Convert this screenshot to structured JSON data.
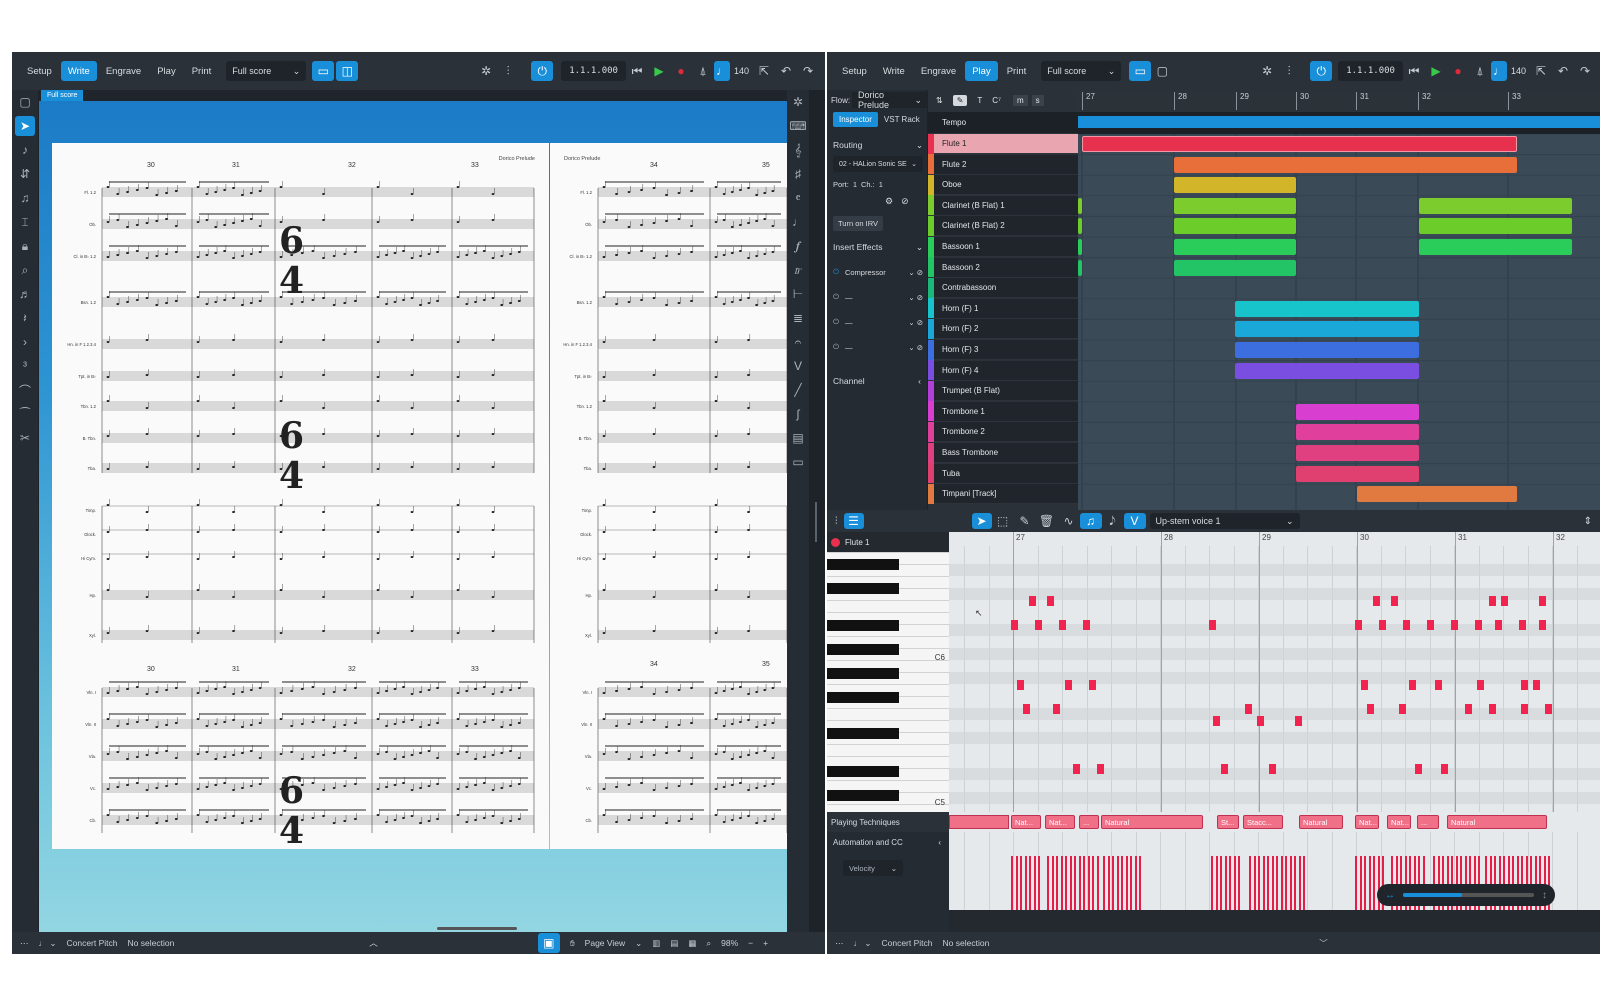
{
  "left": {
    "modes": [
      "Setup",
      "Write",
      "Engrave",
      "Play",
      "Print"
    ],
    "active_mode": "Write",
    "layout_select": "Full score",
    "counter": "1.1.1.000",
    "tempo": "140",
    "tab": "Full score",
    "status": {
      "pitch": "Concert Pitch",
      "selection": "No selection",
      "view": "Page View",
      "zoom": "98%"
    },
    "page_header": "Dorico Prelude",
    "bar_numbers_top": [
      "30",
      "31",
      "32",
      "33"
    ],
    "bar_numbers_bottom": [
      "30",
      "31",
      "32",
      "33"
    ],
    "bar_numbers_right": [
      "34",
      "35"
    ],
    "staff_labels": [
      "Fl. 1.2",
      "Ob.",
      "Cl. in B♭ 1.2",
      "Bsn. 1.2",
      "Hn. in F 1.2.3.4",
      "Tpt. in B♭",
      "Tbn. 1.2",
      "B. Tbn.",
      "Tba.",
      "Timp.",
      "Glock.",
      "Hi Cym.",
      "Hp.",
      "Xyl.",
      "Vln. I",
      "Vln. II",
      "Vla.",
      "Vc.",
      "Cb."
    ],
    "time_signature": {
      "num": "6",
      "den": "4"
    }
  },
  "right": {
    "modes": [
      "Setup",
      "Write",
      "Engrave",
      "Play",
      "Print"
    ],
    "active_mode": "Play",
    "layout_select": "Full score",
    "counter": "1.1.1.000",
    "tempo": "140",
    "flow_label": "Flow:",
    "flow": "Dorico Prelude",
    "inspector_tabs": [
      "Inspector",
      "VST Rack"
    ],
    "routing": "Routing",
    "routing_device": "02 - HALion Sonic SE",
    "port_label": "Port:",
    "port": "1",
    "ch_label": "Ch.:",
    "ch": "1",
    "turn_on_irv": "Turn on IRV",
    "insert_effects": "Insert Effects",
    "inserts": [
      "Compressor",
      "—",
      "—",
      "—"
    ],
    "channel": "Channel",
    "tempo_track": "Tempo",
    "bars": [
      "27",
      "28",
      "29",
      "30",
      "31",
      "32",
      "33"
    ],
    "tracks": [
      {
        "name": "Flute 1",
        "color": "#e8304f"
      },
      {
        "name": "Flute 2",
        "color": "#e86e3a"
      },
      {
        "name": "Oboe",
        "color": "#d3b52a"
      },
      {
        "name": "Clarinet (B Flat) 1",
        "color": "#7ccc2d"
      },
      {
        "name": "Clarinet (B Flat) 2",
        "color": "#6ccc2a"
      },
      {
        "name": "Bassoon 1",
        "color": "#2acc5a"
      },
      {
        "name": "Bassoon 2",
        "color": "#22c466"
      },
      {
        "name": "Contrabassoon",
        "color": "#1bb87a"
      },
      {
        "name": "Horn (F) 1",
        "color": "#18c4cc"
      },
      {
        "name": "Horn (F) 2",
        "color": "#1aa8d8"
      },
      {
        "name": "Horn (F) 3",
        "color": "#3c6ee0"
      },
      {
        "name": "Horn (F) 4",
        "color": "#7a4ee0"
      },
      {
        "name": "Trumpet (B Flat)",
        "color": "#b33ed8"
      },
      {
        "name": "Trombone 1",
        "color": "#d83ed0"
      },
      {
        "name": "Trombone 2",
        "color": "#e0409c"
      },
      {
        "name": "Bass Trombone",
        "color": "#e04080"
      },
      {
        "name": "Tuba",
        "color": "#e04070"
      },
      {
        "name": "Timpani [Track]",
        "color": "#e07a40"
      }
    ],
    "voice_select": "Up-stem voice 1",
    "editor_track": "Flute 1",
    "editor_bars": [
      "27",
      "28",
      "29",
      "30",
      "31",
      "32"
    ],
    "key_labels": [
      "C6",
      "C5"
    ],
    "playing_techniques": "Playing Techniques",
    "pt_labels": [
      "Nat...",
      "Nat...",
      "...",
      "Natural",
      "St...",
      "Stacc...",
      "Natural",
      "Nat...",
      "Nat...",
      "...",
      "Natural"
    ],
    "automation": "Automation and CC",
    "velocity": "Velocity",
    "status": {
      "pitch": "Concert Pitch",
      "selection": "No selection"
    }
  }
}
